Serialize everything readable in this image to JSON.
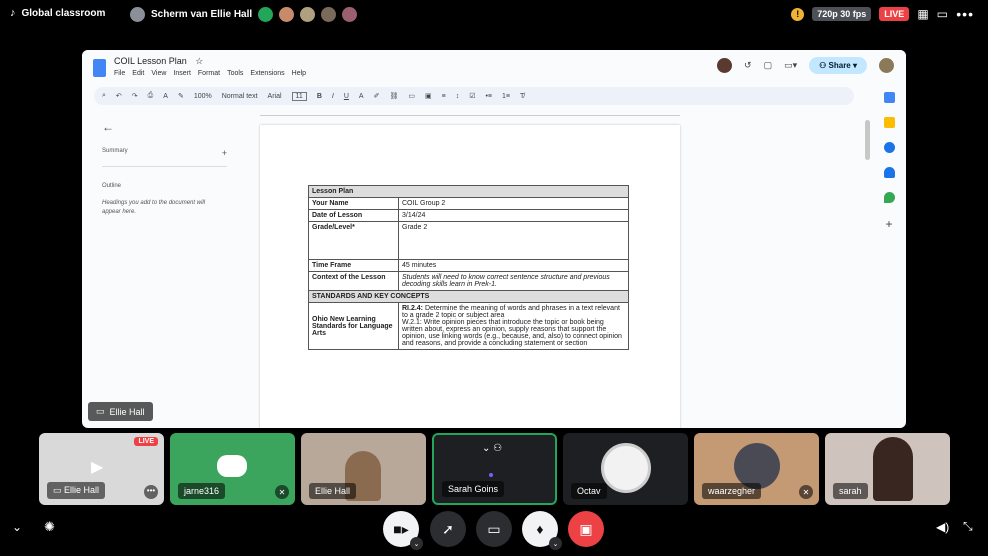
{
  "topbar": {
    "server_name": "Global classroom",
    "channel_name": "Scherm van Ellie Hall",
    "quality": "720p 30 fps",
    "live": "LIVE"
  },
  "doc": {
    "title": "COIL Lesson Plan",
    "menu": [
      "File",
      "Edit",
      "View",
      "Insert",
      "Format",
      "Tools",
      "Extensions",
      "Help"
    ],
    "share_label": "Share",
    "toolbar": {
      "zoom": "100%",
      "style": "Normal text",
      "font": "Arial",
      "size": "11"
    },
    "sidebar": {
      "summary_label": "Summary",
      "outline_label": "Outline",
      "outline_hint": "Headings you add to the document will appear here."
    },
    "table": {
      "header": "Lesson Plan",
      "rows": [
        {
          "label": "Your Name",
          "value": "COIL Group 2"
        },
        {
          "label": "Date of Lesson",
          "value": "3/14/24"
        },
        {
          "label": "Grade/Level*",
          "value": "Grade 2"
        },
        {
          "label": "Time Frame",
          "value": "45 minutes"
        },
        {
          "label": "Context of the Lesson",
          "value": "Students will need to know correct sentence structure and previous decoding skills learn in Prek-1."
        }
      ],
      "section": "STANDARDS AND KEY CONCEPTS",
      "standards_label": "Ohio New Learning Standards for Language Arts",
      "standards_code1": "RI.2.4:",
      "standards_text1": " Determine the meaning of words and phrases in a text relevant to a grade 2 topic or subject area",
      "standards_text2": "W.2.1: Write opinion pieces that introduce the topic or book being written about, express an opinion, supply reasons that support the opinion, use linking words (e.g., because, and, also) to connect opinion and reasons, and provide a concluding statement or section"
    }
  },
  "streamer_tag": "Ellie Hall",
  "participants": [
    {
      "name": "Ellie Hall",
      "tile_live": "LIVE"
    },
    {
      "name": "jarne316"
    },
    {
      "name": "Ellie Hall"
    },
    {
      "name": "Sarah Goins"
    },
    {
      "name": "Octav"
    },
    {
      "name": "waarzegher"
    },
    {
      "name": "sarah"
    }
  ]
}
